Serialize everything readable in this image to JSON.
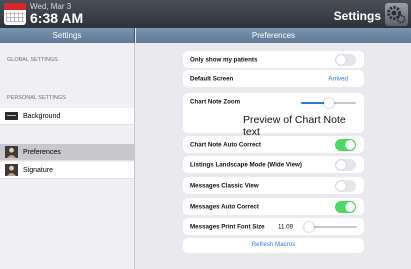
{
  "header": {
    "date": "Wed, Mar 3",
    "time": "6:38 AM",
    "title": "Settings",
    "calendar_icon": "calendar-icon",
    "settings_icon": "gear-icon"
  },
  "sidebar": {
    "nav_title": "Settings",
    "global_header": "GLOBAL SETTINGS",
    "personal_header": "PERSONAL SETTINGS",
    "items": [
      {
        "label": "Background",
        "icon": "background-icon",
        "selected": false
      },
      {
        "label": "Preferences",
        "icon": "person-icon",
        "selected": true
      },
      {
        "label": "Signature",
        "icon": "person-icon",
        "selected": false
      }
    ]
  },
  "main": {
    "nav_title": "Preferences",
    "only_my_patients": {
      "label": "Only show my patients",
      "on": false
    },
    "default_screen": {
      "label": "Default Screen",
      "value": "Arrived"
    },
    "chart_note_zoom": {
      "label": "Chart Note Zoom",
      "preview": "Preview of Chart Note text",
      "level": 0.5
    },
    "chart_note_auto_correct": {
      "label": "Chart Note Auto Correct",
      "on": true
    },
    "listings_landscape": {
      "label": "Listings Landscape Mode (Wide View)",
      "on": false
    },
    "messages_classic": {
      "label": "Messages Classic View",
      "on": false
    },
    "messages_auto_correct": {
      "label": "Messages Auto Correct",
      "on": true
    },
    "messages_font": {
      "label": "Messages Print Font Size",
      "value": "11.09",
      "level": 0.08
    },
    "refresh_macros": "Refresh Macros"
  },
  "colors": {
    "accent": "#2a7ae2",
    "toggle_on": "#4cd964",
    "toggle_off": "#e5e5ea",
    "nav": "#6b85a2"
  }
}
